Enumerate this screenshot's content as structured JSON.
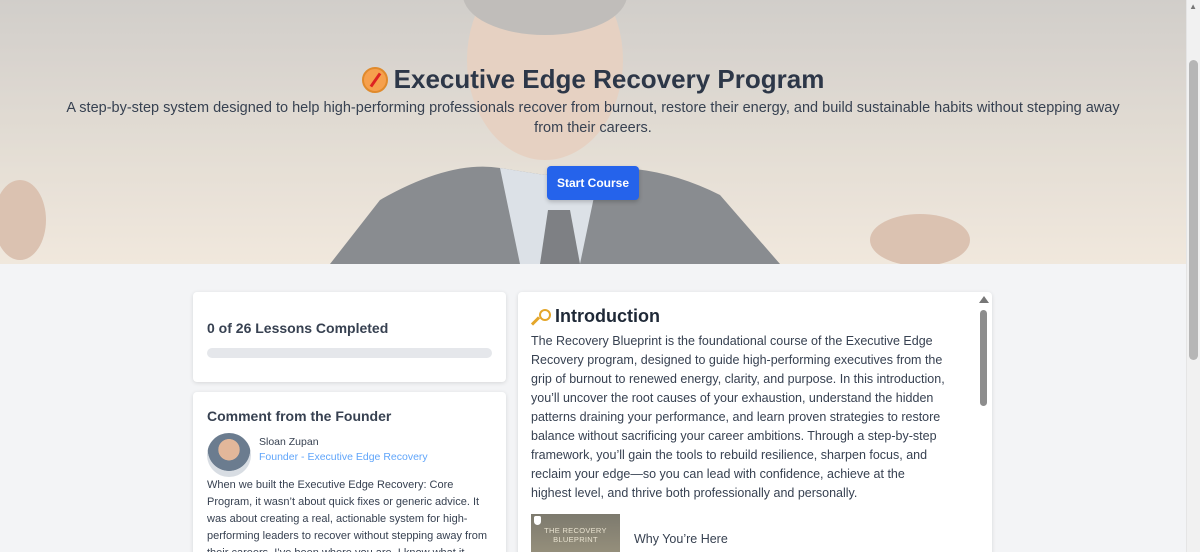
{
  "hero": {
    "title": "Executive Edge Recovery Program",
    "subtitle": "A step-by-step system designed to help high-performing professionals recover from burnout, restore their energy, and build sustainable habits without stepping away from their careers.",
    "cta_label": "Start Course",
    "title_icon": "compass-icon"
  },
  "progress": {
    "label": "0 of 26 Lessons Completed",
    "completed": 0,
    "total": 26,
    "fraction": 0
  },
  "founder": {
    "heading": "Comment from the Founder",
    "name": "Sloan Zupan",
    "role": "Founder - Executive Edge Recovery",
    "comment": "When we built the Executive Edge Recovery: Core Program, it wasn’t about quick fixes or generic advice. It was about creating a real, actionable system for high-performing leaders to recover without stepping away from their careers. I’ve been where you are. I know what it"
  },
  "intro": {
    "heading": "Introduction",
    "heading_icon": "key-icon",
    "body": "The Recovery Blueprint is the foundational course of the Executive Edge Recovery program, designed to guide high-performing executives from the grip of burnout to renewed energy, clarity, and purpose. In this introduction, you’ll uncover the root causes of your exhaustion, understand the hidden patterns draining your performance, and learn proven strategies to restore balance without sacrificing your career ambitions. Through a step-by-step framework, you’ll gain the tools to rebuild resilience, sharpen focus, and reclaim your edge—so you can lead with confidence, achieve at the highest level, and thrive both professionally and personally.",
    "lessons": [
      {
        "thumb_text": "THE RECOVERY BLUEPRINT",
        "title": "Why You’re Here"
      }
    ]
  },
  "colors": {
    "accent": "#2563eb",
    "founder_role": "#60a5fa",
    "background": "#f3f4f6"
  }
}
